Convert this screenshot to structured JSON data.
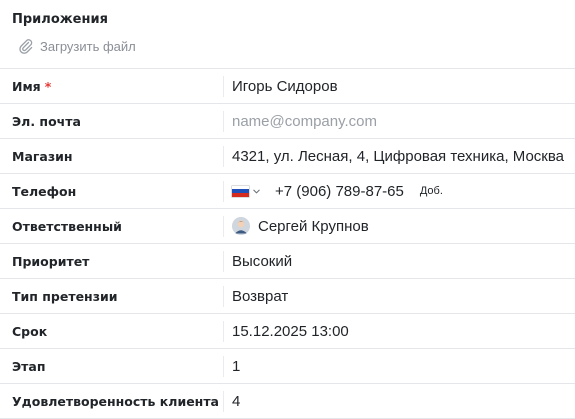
{
  "attachments": {
    "title": "Приложения",
    "upload_label": "Загрузить файл"
  },
  "fields": {
    "name": {
      "label": "Имя",
      "required_mark": "*",
      "value": "Игорь Сидоров"
    },
    "email": {
      "label": "Эл. почта",
      "placeholder": "name@company.com"
    },
    "store": {
      "label": "Магазин",
      "value": "4321, ул. Лесная, 4, Цифровая техника, Москва"
    },
    "phone": {
      "label": "Телефон",
      "value": "+7 (906) 789-87-65",
      "ext_label": "Доб."
    },
    "responsible": {
      "label": "Ответственный",
      "value": "Сергей Крупнов"
    },
    "priority": {
      "label": "Приоритет",
      "value": "Высокий"
    },
    "claim_type": {
      "label": "Тип претензии",
      "value": "Возврат"
    },
    "deadline": {
      "label": "Срок",
      "value": "15.12.2025 13:00"
    },
    "stage": {
      "label": "Этап",
      "value": "1"
    },
    "satisfaction": {
      "label": "Удовлетворенность клиента",
      "value": "4"
    }
  },
  "colors": {
    "required": "#e53935",
    "placeholder": "#9aa0a6",
    "border": "#e4e6e9"
  },
  "icons": {
    "upload": "paperclip-icon",
    "country": "russia-flag-icon",
    "country_toggle": "chevron-down-icon",
    "responsible": "user-avatar"
  }
}
